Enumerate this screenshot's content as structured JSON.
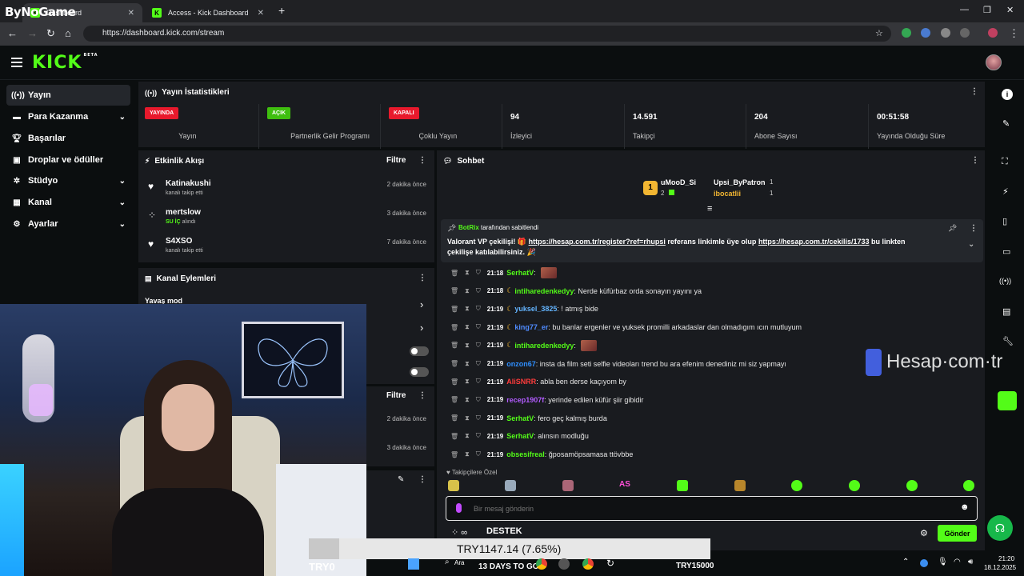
{
  "browser": {
    "overlay_brand": "ByNoGame",
    "tabs": [
      {
        "label": "Dashboard",
        "active": true
      },
      {
        "label": "Access - Kick Dashboard",
        "active": false
      }
    ],
    "url": "https://dashboard.kick.com/stream"
  },
  "header": {
    "logo": "KICK",
    "logo_badge": "BETA"
  },
  "sidebar": {
    "items": [
      {
        "label": "Yayın",
        "icon": "broadcast-icon",
        "active": true
      },
      {
        "label": "Para Kazanma",
        "icon": "money-icon",
        "expandable": true
      },
      {
        "label": "Başarılar",
        "icon": "trophy-icon"
      },
      {
        "label": "Droplar ve ödüller",
        "icon": "gift-icon"
      },
      {
        "label": "Stüdyo",
        "icon": "gear-icon",
        "expandable": true
      },
      {
        "label": "Kanal",
        "icon": "channel-icon",
        "expandable": true
      },
      {
        "label": "Ayarlar",
        "icon": "settings-icon",
        "expandable": true
      }
    ]
  },
  "stats": {
    "title": "Yayın İstatistikleri",
    "items": [
      {
        "badge": "YAYINDA",
        "badge_color": "#e8192c",
        "label": "Yayın"
      },
      {
        "badge": "AÇIK",
        "badge_color": "#3fbf0f",
        "label": "Partnerlik Gelir Programı"
      },
      {
        "badge": "KAPALI",
        "badge_color": "#e8192c",
        "label": "Çoklu Yayın"
      },
      {
        "value": "94",
        "label": "İzleyici"
      },
      {
        "value": "14.591",
        "label": "Takipçi"
      },
      {
        "value": "204",
        "label": "Abone Sayısı"
      },
      {
        "value": "00:51:58",
        "label": "Yayında Olduğu Süre"
      }
    ]
  },
  "activity": {
    "title": "Etkinlik Akışı",
    "filter": "Filtre",
    "items": [
      {
        "name": "Katinakushi",
        "sub": "kanalı takip etti",
        "time": "2 dakika önce",
        "icon": "heart-icon"
      },
      {
        "name": "mertslow",
        "sub_highlight": "SU İÇ",
        "sub": " alındı",
        "time": "3 dakika önce",
        "icon": "points-icon"
      },
      {
        "name": "S4XSO",
        "sub": "kanalı takip etti",
        "time": "7 dakika önce",
        "icon": "heart-icon"
      }
    ]
  },
  "channel_actions": {
    "title": "Kanal Eylemleri",
    "slow_mode": "Yavaş mod"
  },
  "second_feed": {
    "filter": "Filtre",
    "times": [
      "2 dakika önce",
      "3 dakika önce"
    ]
  },
  "chat": {
    "title": "Sohbet",
    "top_gifters": [
      {
        "rank": "1",
        "name": "uMooD_Si",
        "count": "2"
      },
      {
        "name": "Upsi_ByPatron",
        "count": "1"
      },
      {
        "name": "ibocatlii",
        "count": "1"
      }
    ],
    "pinned": {
      "by": "BotRix",
      "by_suffix": "tarafından sabitlendi",
      "text_1": "Valorant VP çekilişi! 🎁 ",
      "link_1": "https://hesap.com.tr/register?ref=rhupsi",
      "text_2": " referans linkimle üye olup ",
      "link_2": "https://hesap.com.tr/cekilis/1733",
      "text_3": " bu linkten",
      "line_2": "çekilişe katılabilirsiniz. 🎉"
    },
    "messages": [
      {
        "time": "21:18",
        "user": "SerhatV",
        "color": "#53fc18",
        "text": "",
        "emote": true,
        "moon": false
      },
      {
        "time": "21:18",
        "user": "intiharedenkedyy",
        "color": "#53fc18",
        "text": "Nerde küfürbaz orda sonayın yayını ya",
        "moon": true
      },
      {
        "time": "21:19",
        "user": "yuksel_3825",
        "color": "#63b4ff",
        "text": "! atmış bide",
        "moon": true
      },
      {
        "time": "21:19",
        "user": "king77_er",
        "color": "#4f8bff",
        "text": "bu banlar ergenler ve yuksek promilli arkadaslar dan olmadıgım ıcın mutluyum",
        "moon": true
      },
      {
        "time": "21:19",
        "user": "intiharedenkedyy",
        "color": "#53fc18",
        "text": "",
        "emote": true,
        "moon": true
      },
      {
        "time": "21:19",
        "user": "onzon67",
        "color": "#2f8fff",
        "text": "insta da film seti selfie videoları trend bu ara efenim denediniz mi siz yapmayı",
        "moon": false
      },
      {
        "time": "21:19",
        "user": "AliSNRR",
        "color": "#ff3b3b",
        "text": "abla ben derse kaçıyom by",
        "moon": false
      },
      {
        "time": "21:19",
        "user": "recep1907f",
        "color": "#b25cff",
        "text": "yerinde edilen küfür şiir gibidir",
        "moon": false
      },
      {
        "time": "21:19",
        "user": "SerhatV",
        "color": "#53fc18",
        "text": "fero geç kalmış burda",
        "moon": false
      },
      {
        "time": "21:19",
        "user": "SerhatV",
        "color": "#53fc18",
        "text": "alınsın modluğu",
        "moon": false
      },
      {
        "time": "21:19",
        "user": "obsesifreal",
        "color": "#53fc18",
        "text": "ğposamöpsamasa ttövbbe",
        "moon": false
      }
    ],
    "followers_only": "Takipçilere Özel",
    "input_placeholder": "Bir mesaj gönderin",
    "send": "Gönder",
    "destek": "DESTEK"
  },
  "watermark": "Hesap·com·tr",
  "ticker": {
    "main": "TRY1147.14 (7.65%)",
    "left": "TRY0",
    "right": "TRY15000",
    "days": "13 DAYS TO GO"
  },
  "taskbar": {
    "search": "Ara",
    "time": "21:20",
    "date": "18.12.2025"
  }
}
